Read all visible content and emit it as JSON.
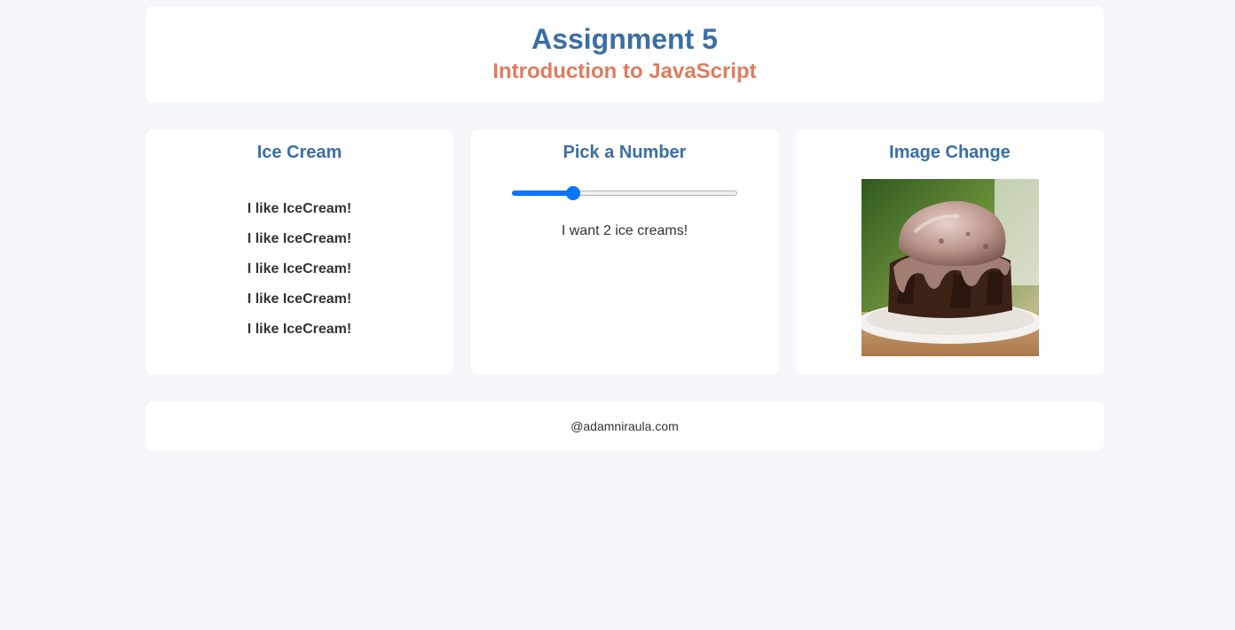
{
  "header": {
    "title": "Assignment 5",
    "subtitle": "Introduction to JavaScript"
  },
  "ice_cream": {
    "heading": "Ice Cream",
    "lines": [
      "I like IceCream!",
      "I like IceCream!",
      "I like IceCream!",
      "I like IceCream!",
      "I like IceCream!"
    ]
  },
  "pick_number": {
    "heading": "Pick a Number",
    "slider_position": 0.27,
    "message": "I want 2 ice creams!"
  },
  "image_change": {
    "heading": "Image Change"
  },
  "footer": {
    "text": "@adamniraula.com"
  },
  "colors": {
    "accent": "#3a6ea5",
    "subtitle": "#e07b5f",
    "slider": "#0a75ff",
    "background": "#f5f6fa"
  }
}
